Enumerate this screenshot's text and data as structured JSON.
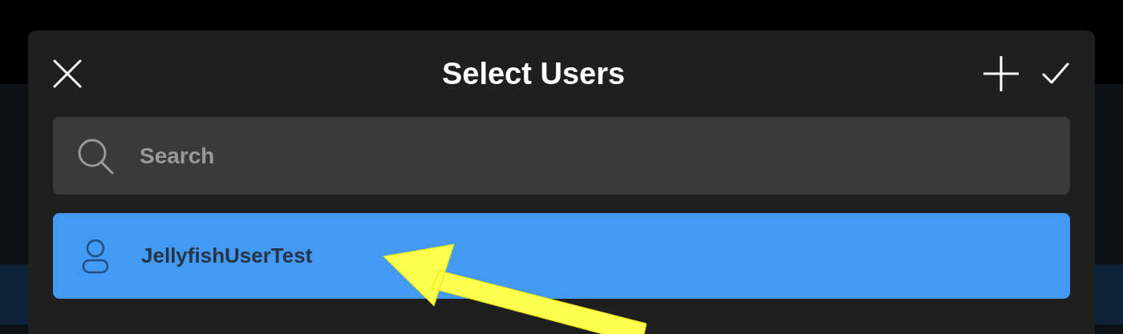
{
  "dialog": {
    "title": "Select Users"
  },
  "search": {
    "placeholder": "Search"
  },
  "users": [
    {
      "name": "JellyfishUserTest",
      "selected": true
    }
  ]
}
